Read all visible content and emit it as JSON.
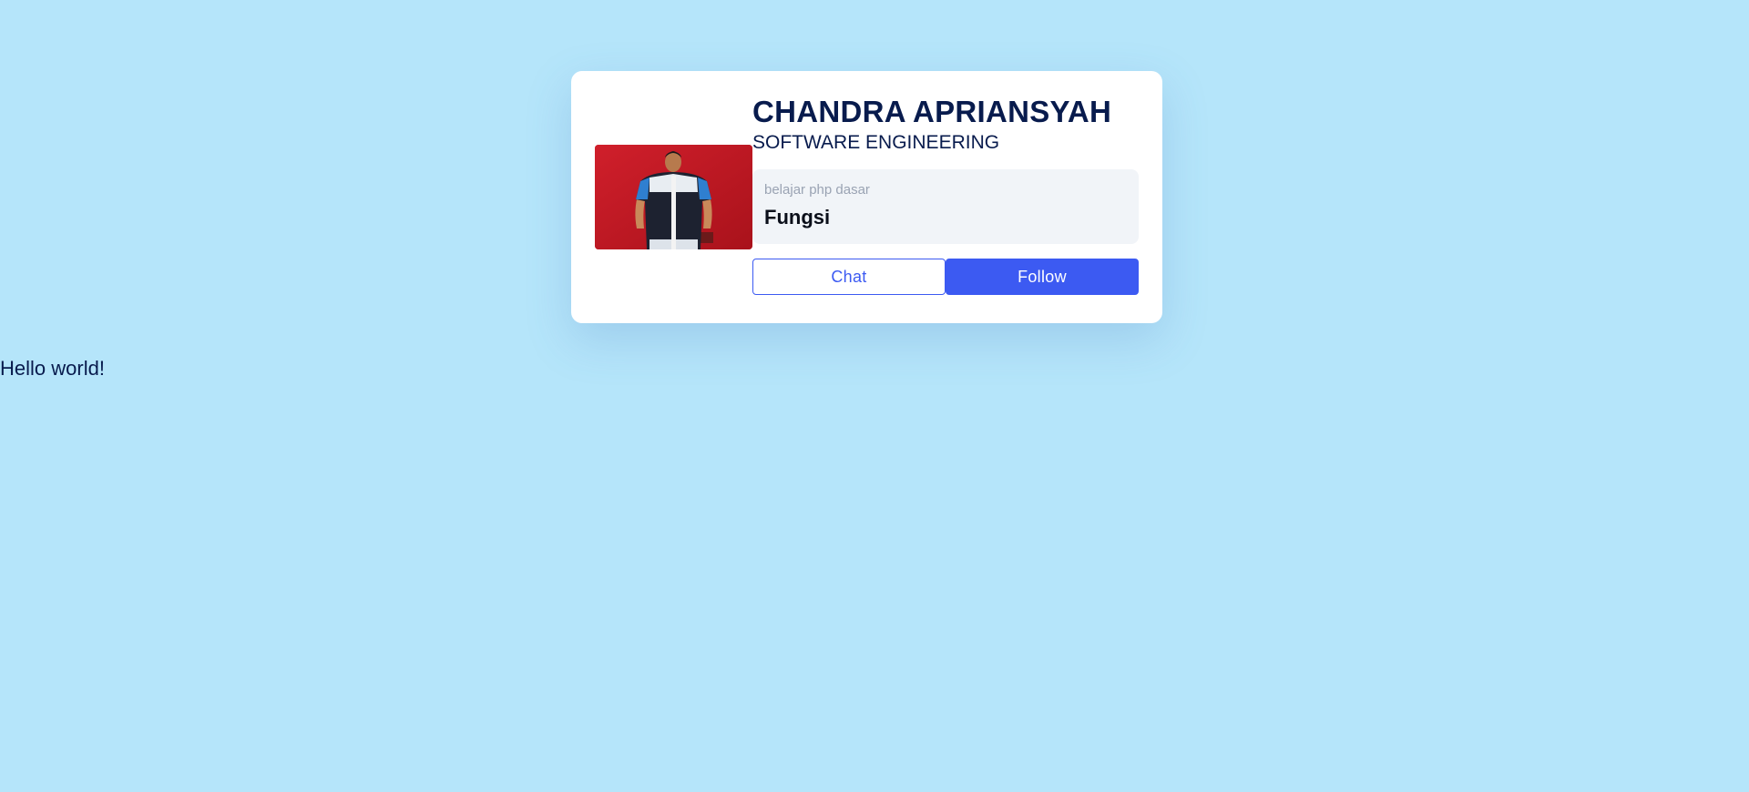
{
  "profile": {
    "name": "CHANDRA APRIANSYAH",
    "role": "SOFTWARE ENGINEERING",
    "photo_icon": "profile-photo"
  },
  "topic": {
    "caption": "belajar php dasar",
    "title": "Fungsi"
  },
  "actions": {
    "chat_label": "Chat",
    "follow_label": "Follow"
  },
  "body_text": "Hello world!",
  "colors": {
    "background": "#b5e5fa",
    "card": "#ffffff",
    "accent": "#3c5af2",
    "heading": "#081b4d",
    "topic_box": "#f1f4f8",
    "photo_backdrop": "#c81a24"
  }
}
